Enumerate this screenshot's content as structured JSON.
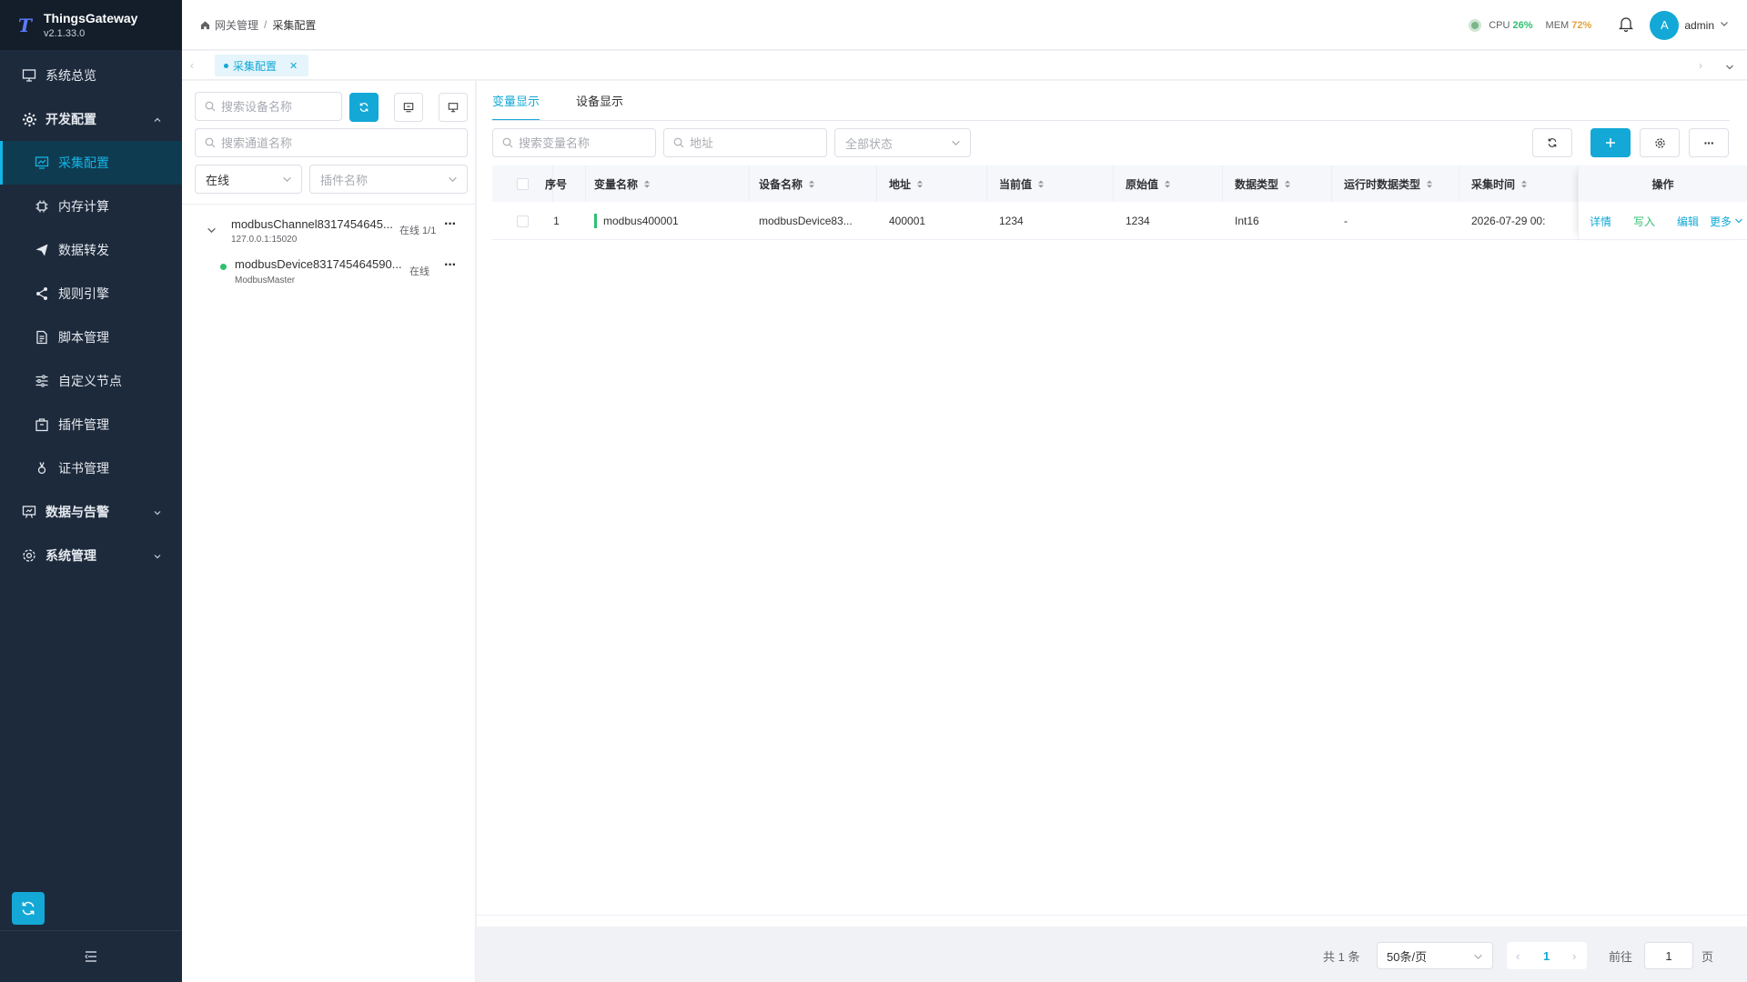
{
  "app": {
    "name": "ThingsGateway",
    "version": "v2.1.33.0"
  },
  "sidebar": {
    "items": [
      {
        "label": "系统总览",
        "icon": "monitor-icon"
      },
      {
        "label": "开发配置",
        "icon": "gear-icon"
      },
      {
        "label": "采集配置",
        "icon": "chart-icon"
      },
      {
        "label": "内存计算",
        "icon": "chip-icon"
      },
      {
        "label": "数据转发",
        "icon": "send-icon"
      },
      {
        "label": "规则引擎",
        "icon": "share-icon"
      },
      {
        "label": "脚本管理",
        "icon": "file-icon"
      },
      {
        "label": "自定义节点",
        "icon": "sliders-icon"
      },
      {
        "label": "插件管理",
        "icon": "package-icon"
      },
      {
        "label": "证书管理",
        "icon": "certificate-icon"
      },
      {
        "label": "数据与告警",
        "icon": "alarm-board-icon"
      },
      {
        "label": "系统管理",
        "icon": "gear-icon"
      }
    ]
  },
  "header": {
    "breadcrumb": [
      "网关管理",
      "采集配置"
    ],
    "cpu_label": "CPU",
    "cpu_value": "26%",
    "mem_label": "MEM",
    "mem_value": "72%",
    "user_initial": "A",
    "user_name": "admin"
  },
  "tabs": {
    "active": "采集配置"
  },
  "left": {
    "search_device_placeholder": "搜索设备名称",
    "search_channel_placeholder": "搜索通道名称",
    "status_select": "在线",
    "plugin_placeholder": "插件名称",
    "channel": {
      "name": "modbusChannel8317454645...",
      "address": "127.0.0.1:15020",
      "status": "在线 1/1"
    },
    "device": {
      "name": "modbusDevice831745464590...",
      "plugin": "ModbusMaster",
      "status": "在线"
    }
  },
  "main": {
    "tabs": [
      "变量显示",
      "设备显示"
    ],
    "search_var_placeholder": "搜索变量名称",
    "address_placeholder": "地址",
    "status_placeholder": "全部状态",
    "columns": [
      "序号",
      "变量名称",
      "设备名称",
      "地址",
      "当前值",
      "原始值",
      "数据类型",
      "运行时数据类型",
      "采集时间",
      "操作"
    ],
    "rows": [
      {
        "index": "1",
        "name": "modbus400001",
        "device": "modbusDevice83...",
        "address": "400001",
        "current": "1234",
        "raw": "1234",
        "type": "Int16",
        "runtime_type": "-",
        "time": "2026-07-29 00:"
      }
    ],
    "row_actions": [
      "详情",
      "写入",
      "编辑",
      "更多"
    ]
  },
  "pagination": {
    "total": "共 1 条",
    "page_size": "50条/页",
    "current": "1",
    "goto_label": "前往",
    "goto_value": "1",
    "page_suffix": "页"
  },
  "colors": {
    "accent": "#13a8d6",
    "sidebar_bg": "#1d2a3b",
    "online": "#2fbf71",
    "mem_warn": "#e6a23c"
  }
}
